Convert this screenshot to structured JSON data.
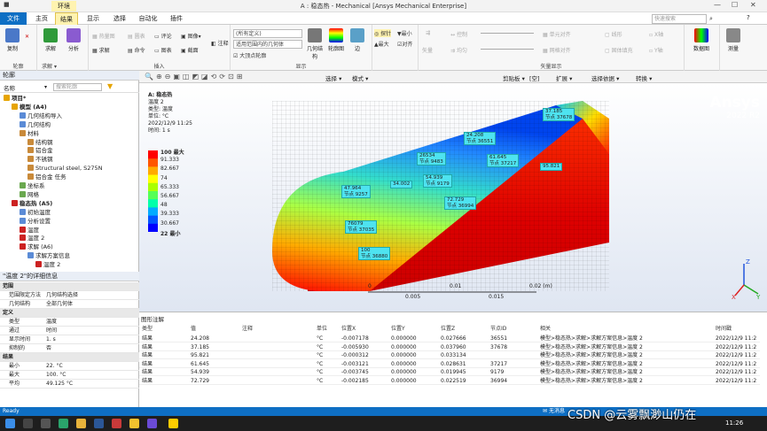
{
  "title": "A : 稳态热 - Mechanical [Ansys Mechanical Enterprise]",
  "context_tab": "环境",
  "tabs": [
    "文件",
    "主页",
    "结果",
    "显示",
    "选择",
    "自动化",
    "插件"
  ],
  "search_placeholder": "快速搜索",
  "ribbon": {
    "groups": [
      "轮廓",
      "插入",
      "显示",
      "矢量显示"
    ],
    "buttons": [
      "复制",
      "求解",
      "分析",
      "热量图",
      "圆表",
      "评论",
      "图像",
      "注释",
      "几何结构",
      "轮廓图",
      "边",
      "探针",
      "最大",
      "最小",
      "对齐",
      "矢量",
      "控制",
      "均匀",
      "数据图",
      "测量"
    ],
    "scope_select": "(所有定义)",
    "scope_select2": "适用范围内的几何体",
    "max_label": "大顶点轮廓"
  },
  "outline": {
    "header": "轮廓",
    "name_label": "名称",
    "search_placeholder": "搜索轮廓",
    "items": [
      {
        "label": "项目*",
        "indent": 0,
        "color": "#e6a400"
      },
      {
        "label": "模型 (A4)",
        "indent": 1,
        "color": "#e6a400"
      },
      {
        "label": "几何结构导入",
        "indent": 2,
        "color": "#5b8bd6"
      },
      {
        "label": "几何结构",
        "indent": 2,
        "color": "#5b8bd6"
      },
      {
        "label": "材料",
        "indent": 2,
        "color": "#c98a3a"
      },
      {
        "label": "结构钢",
        "indent": 3,
        "color": "#c98a3a"
      },
      {
        "label": "铝合金",
        "indent": 3,
        "color": "#c98a3a"
      },
      {
        "label": "不锈钢",
        "indent": 3,
        "color": "#c98a3a"
      },
      {
        "label": "Structural steel, S275N",
        "indent": 3,
        "color": "#c98a3a"
      },
      {
        "label": "铝合金 任务",
        "indent": 3,
        "color": "#c98a3a"
      },
      {
        "label": "坐标系",
        "indent": 2,
        "color": "#6aa84f"
      },
      {
        "label": "网格",
        "indent": 2,
        "color": "#6aa84f"
      },
      {
        "label": "稳态热 (A5)",
        "indent": 1,
        "color": "#cc2222"
      },
      {
        "label": "初始温度",
        "indent": 2,
        "color": "#5b8bd6"
      },
      {
        "label": "分析设置",
        "indent": 2,
        "color": "#5b8bd6"
      },
      {
        "label": "温度",
        "indent": 2,
        "color": "#cc2222"
      },
      {
        "label": "温度 2",
        "indent": 2,
        "color": "#cc2222"
      },
      {
        "label": "求解 (A6)",
        "indent": 2,
        "color": "#cc2222"
      },
      {
        "label": "求解方案信息",
        "indent": 3,
        "color": "#5b8bd6"
      },
      {
        "label": "温度 2",
        "indent": 4,
        "color": "#cc2222"
      }
    ]
  },
  "details": {
    "header": "\"温度 2\"的详细信息",
    "rows": [
      {
        "k": "范围",
        "v": "",
        "sec": true
      },
      {
        "k": "范围限定方法",
        "v": "几何结构选择"
      },
      {
        "k": "几何结构",
        "v": "全部几何体"
      },
      {
        "k": "定义",
        "v": "",
        "sec": true
      },
      {
        "k": "类型",
        "v": "温度"
      },
      {
        "k": "通过",
        "v": "时间"
      },
      {
        "k": "显示时间",
        "v": "1. s"
      },
      {
        "k": "抑制的",
        "v": "否"
      },
      {
        "k": "结果",
        "v": "",
        "sec": true
      },
      {
        "k": "最小",
        "v": "22. °C"
      },
      {
        "k": "最大",
        "v": "100. °C"
      },
      {
        "k": "平均",
        "v": "49.125 °C"
      }
    ]
  },
  "viewport": {
    "info": [
      "A: 稳态热",
      "温度 2",
      "类型: 温度",
      "单位: °C",
      "2022/12/9 11:25",
      "时间: 1 s"
    ],
    "legend": [
      "100 最大",
      "91.333",
      "82.667",
      "74",
      "65.333",
      "56.667",
      "48",
      "39.333",
      "30.667",
      "22 最小"
    ],
    "legend_colors": [
      "#ff0000",
      "#ff5500",
      "#ffaa00",
      "#ffff00",
      "#aaff00",
      "#55ff55",
      "#00ffaa",
      "#00aaff",
      "#0055ff",
      "#0000ff"
    ],
    "brand": "Ansys",
    "version": "2022 R2",
    "scale_ticks": [
      "0",
      "0.005",
      "0.01",
      "0.015",
      "0.02 (m)"
    ],
    "callouts": [
      {
        "val": "37.185",
        "node": "节点 37678"
      },
      {
        "val": "24.208",
        "node": "节点 36551"
      },
      {
        "val": "26534",
        "node": "节点 9483"
      },
      {
        "val": "61.645",
        "node": "节点 37217"
      },
      {
        "val": "95.821",
        "node": ""
      },
      {
        "val": "34.002",
        "node": ""
      },
      {
        "val": "54.939",
        "node": "节点 9179"
      },
      {
        "val": "47.964",
        "node": "节点 9257"
      },
      {
        "val": "72.729",
        "node": "节点 36994"
      },
      {
        "val": "76079",
        "node": "节点 37035"
      },
      {
        "val": "100",
        "node": "节点 36880"
      }
    ]
  },
  "graphics_annotations": {
    "header": "图形注解",
    "columns": [
      "类型",
      "值",
      "注释",
      "单位",
      "位置X",
      "位置Y",
      "位置Z",
      "节点ID",
      "相关",
      "时间戳"
    ],
    "rows": [
      [
        "结果",
        "24.208",
        "",
        "°C",
        "-0.007178",
        "0.000000",
        "0.027666",
        "36551",
        "模型>稳态热>求解>求解方案信息>温度 2",
        "2022/12/9 11:2"
      ],
      [
        "结果",
        "37.185",
        "",
        "°C",
        "-0.005930",
        "0.000000",
        "0.037960",
        "37678",
        "模型>稳态热>求解>求解方案信息>温度 2",
        "2022/12/9 11:2"
      ],
      [
        "结果",
        "95.821",
        "",
        "°C",
        "-0.000312",
        "0.000000",
        "0.033134",
        "",
        "模型>稳态热>求解>求解方案信息>温度 2",
        "2022/12/9 11:2"
      ],
      [
        "结果",
        "61.645",
        "",
        "°C",
        "-0.003121",
        "0.000000",
        "0.028631",
        "37217",
        "模型>稳态热>求解>求解方案信息>温度 2",
        "2022/12/9 11:2"
      ],
      [
        "结果",
        "54.939",
        "",
        "°C",
        "-0.003745",
        "0.000000",
        "0.019945",
        "9179",
        "模型>稳态热>求解>求解方案信息>温度 2",
        "2022/12/9 11:2"
      ],
      [
        "结果",
        "72.729",
        "",
        "°C",
        "-0.002185",
        "0.000000",
        "0.022519",
        "36994",
        "模型>稳态热>求解>求解方案信息>温度 2",
        "2022/12/9 11:2"
      ]
    ]
  },
  "status": {
    "left": "Ready",
    "messages": "无消息",
    "watermark": "CSDN @云雾飘渺山仍在",
    "clock": "11:26"
  }
}
